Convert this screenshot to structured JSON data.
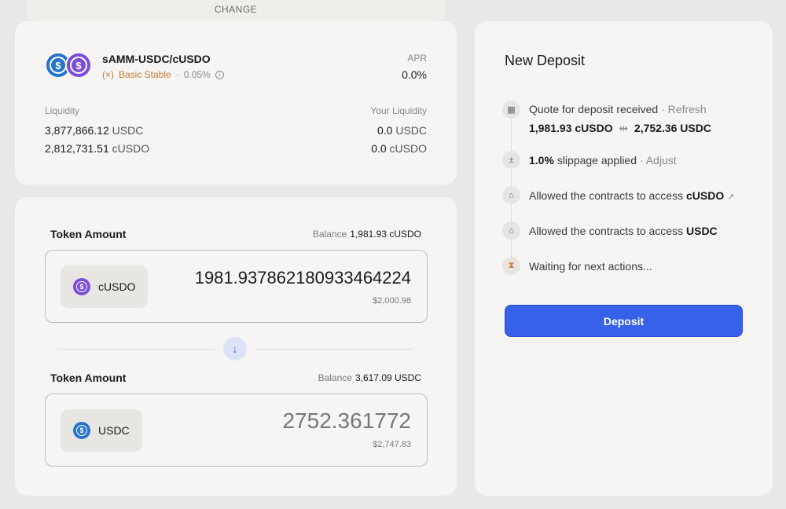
{
  "header": {
    "change_label": "CHANGE"
  },
  "pool": {
    "pair_name": "sAMM-USDC/cUSDO",
    "pool_type": "Basic Stable",
    "separator": "·",
    "fee": "0.05%",
    "apr_label": "APR",
    "apr_value": "0.0%",
    "liquidity_label": "Liquidity",
    "your_liquidity_label": "Your Liquidity",
    "liquidity": [
      {
        "amount": "3,877,866.12",
        "unit": "USDC"
      },
      {
        "amount": "2,812,731.51",
        "unit": "cUSDO"
      }
    ],
    "your_liquidity": [
      {
        "amount": "0.0",
        "unit": "USDC"
      },
      {
        "amount": "0.0",
        "unit": "cUSDO"
      }
    ]
  },
  "deposit": {
    "token_in": {
      "label": "Token Amount",
      "balance_label": "Balance",
      "balance_value": "1,981.93 cUSDO",
      "symbol": "cUSDO",
      "amount": "1981.937862180933464224",
      "usd_value": "$2,000.98"
    },
    "token_out": {
      "label": "Token Amount",
      "balance_label": "Balance",
      "balance_value": "3,617.09 USDC",
      "symbol": "USDC",
      "amount": "2752.361772",
      "usd_value": "$2,747.83"
    }
  },
  "side": {
    "title": "New Deposit",
    "steps": {
      "quote": {
        "text": "Quote for deposit received",
        "sep": "·",
        "action": "Refresh",
        "amount_a": "1,981.93 cUSDO",
        "amount_b": "2,752.36 USDC"
      },
      "slippage": {
        "value": "1.0%",
        "text": "slippage applied",
        "sep": "·",
        "action": "Adjust"
      },
      "allow_cusdo": {
        "text": "Allowed the contracts to access",
        "token": "cUSDO"
      },
      "allow_usdc": {
        "text": "Allowed the contracts to access",
        "token": "USDC"
      },
      "waiting": {
        "text": "Waiting for next actions..."
      }
    },
    "deposit_button": "Deposit"
  },
  "colors": {
    "accent": "#3661e8",
    "usdc": "#2775ca",
    "cusdo": "#7c4ddb",
    "stable": "#c47b3c"
  },
  "icons": [
    "usdc-coin-icon",
    "cusdo-coin-icon",
    "stable-icon",
    "info-icon",
    "arrow-down-icon",
    "calculator-icon",
    "plus-minus-icon",
    "lock-open-icon",
    "hourglass-icon",
    "external-link-icon",
    "exchange-icon"
  ]
}
